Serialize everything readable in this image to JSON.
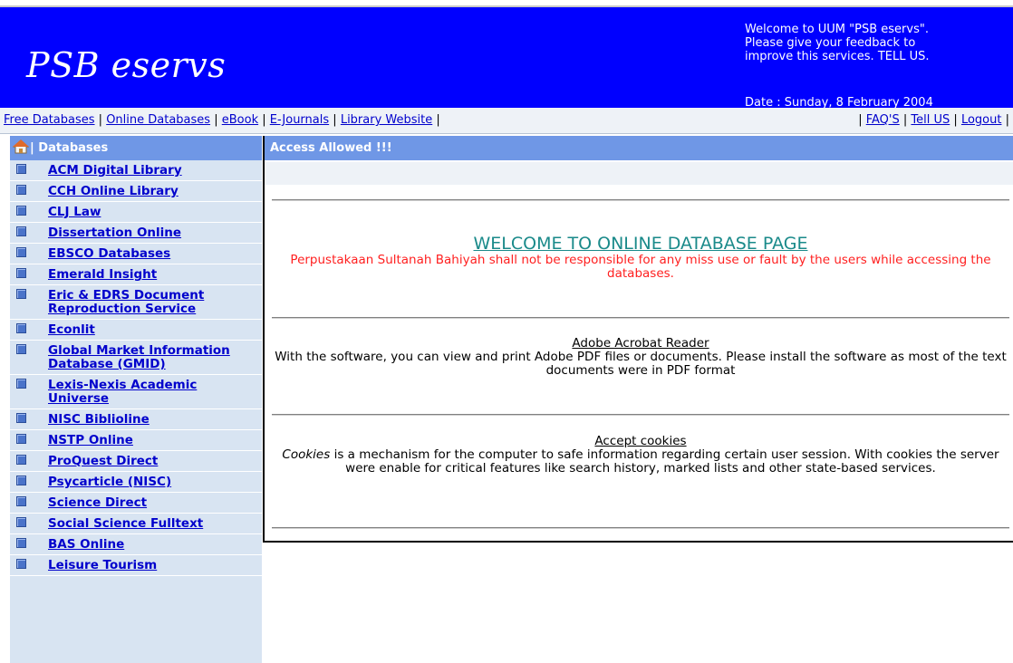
{
  "banner": {
    "logo": "PSB eservs",
    "welcome_lines": [
      "Welcome to UUM \"PSB eservs\".",
      "Please give your feedback to",
      "improve this services.  TELL US."
    ],
    "date": "Date : Sunday, 8 February 2004"
  },
  "nav": {
    "left": [
      "Free Databases",
      "Online Databases",
      "eBook",
      "E-Journals",
      "Library Website"
    ],
    "right": [
      "FAQ'S",
      "Tell US",
      "Logout"
    ],
    "separator": "|"
  },
  "sidebar": {
    "header_icon": "home-icon",
    "title": "| Databases",
    "items": [
      {
        "label": "ACM Digital Library"
      },
      {
        "label": "CCH Online Library"
      },
      {
        "label": "CLJ Law"
      },
      {
        "label": "Dissertation Online"
      },
      {
        "label": "EBSCO Databases"
      },
      {
        "label": "Emerald Insight"
      },
      {
        "label": "Eric & EDRS Document Reproduction Service"
      },
      {
        "label": "Econlit"
      },
      {
        "label": "Global Market Information Database (GMID)"
      },
      {
        "label": "Lexis-Nexis Academic Universe"
      },
      {
        "label": "NISC Biblioline"
      },
      {
        "label": "NSTP Online"
      },
      {
        "label": "ProQuest Direct"
      },
      {
        "label": "Psycarticle (NISC)"
      },
      {
        "label": "Science Direct"
      },
      {
        "label": "Social Science Fulltext"
      },
      {
        "label": "BAS Online"
      },
      {
        "label": "Leisure Tourism"
      }
    ],
    "bullet_icon": "square-bullet-icon"
  },
  "main": {
    "header": "Access Allowed !!!",
    "welcome_title": "WELCOME TO ONLINE DATABASE PAGE",
    "disclaimer": "Perpustakaan Sultanah Bahiyah shall not be responsible for any miss use or fault by the users while accessing the databases.",
    "acrobat_title": "Adobe Acrobat Reader",
    "acrobat_text": "With the software, you can view and print Adobe PDF files or documents. Please install the software as most of the text documents were in PDF format",
    "cookies_title": "Accept cookies",
    "cookies_term": "Cookies",
    "cookies_text": " is a mechanism for the computer to safe information regarding  certain user session.  With cookies the  server were enable for critical features like search history, marked lists and other state-based services."
  },
  "colors": {
    "banner": "#0000ff",
    "header_bar": "#6f97e6",
    "sidebar_bg": "#d8e4f2",
    "link": "#0000cc",
    "welcome_title": "#1a8a8a",
    "disclaimer": "#ff2020"
  }
}
